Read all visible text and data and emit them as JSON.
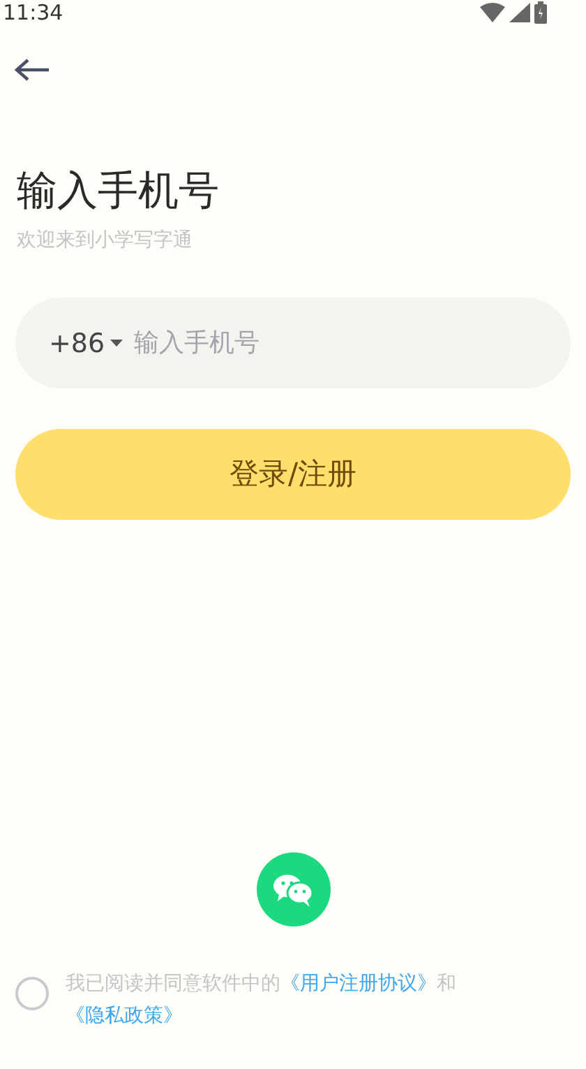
{
  "status_bar": {
    "time": "11:34"
  },
  "title": "输入手机号",
  "subtitle": "欢迎来到小学写字通",
  "phone_field": {
    "country_code": "+86",
    "placeholder": "输入手机号"
  },
  "submit_button": "登录/注册",
  "agreement": {
    "checked": false,
    "text": "我已阅读并同意软件中的",
    "link_1": "《用户注册协议》",
    "joiner": "和",
    "link_2": "《隐私政策》"
  }
}
